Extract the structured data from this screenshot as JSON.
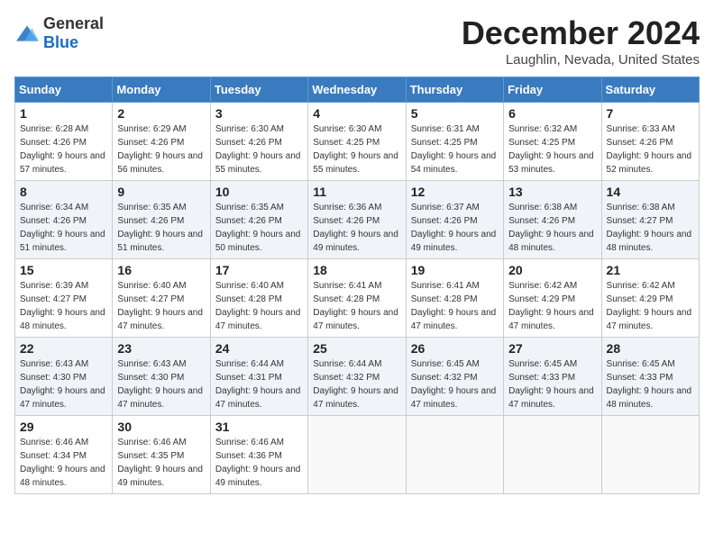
{
  "header": {
    "logo_general": "General",
    "logo_blue": "Blue",
    "month": "December 2024",
    "location": "Laughlin, Nevada, United States"
  },
  "days_of_week": [
    "Sunday",
    "Monday",
    "Tuesday",
    "Wednesday",
    "Thursday",
    "Friday",
    "Saturday"
  ],
  "weeks": [
    [
      {
        "day": "1",
        "sunrise": "6:28 AM",
        "sunset": "4:26 PM",
        "daylight": "9 hours and 57 minutes."
      },
      {
        "day": "2",
        "sunrise": "6:29 AM",
        "sunset": "4:26 PM",
        "daylight": "9 hours and 56 minutes."
      },
      {
        "day": "3",
        "sunrise": "6:30 AM",
        "sunset": "4:26 PM",
        "daylight": "9 hours and 55 minutes."
      },
      {
        "day": "4",
        "sunrise": "6:30 AM",
        "sunset": "4:25 PM",
        "daylight": "9 hours and 55 minutes."
      },
      {
        "day": "5",
        "sunrise": "6:31 AM",
        "sunset": "4:25 PM",
        "daylight": "9 hours and 54 minutes."
      },
      {
        "day": "6",
        "sunrise": "6:32 AM",
        "sunset": "4:25 PM",
        "daylight": "9 hours and 53 minutes."
      },
      {
        "day": "7",
        "sunrise": "6:33 AM",
        "sunset": "4:26 PM",
        "daylight": "9 hours and 52 minutes."
      }
    ],
    [
      {
        "day": "8",
        "sunrise": "6:34 AM",
        "sunset": "4:26 PM",
        "daylight": "9 hours and 51 minutes."
      },
      {
        "day": "9",
        "sunrise": "6:35 AM",
        "sunset": "4:26 PM",
        "daylight": "9 hours and 51 minutes."
      },
      {
        "day": "10",
        "sunrise": "6:35 AM",
        "sunset": "4:26 PM",
        "daylight": "9 hours and 50 minutes."
      },
      {
        "day": "11",
        "sunrise": "6:36 AM",
        "sunset": "4:26 PM",
        "daylight": "9 hours and 49 minutes."
      },
      {
        "day": "12",
        "sunrise": "6:37 AM",
        "sunset": "4:26 PM",
        "daylight": "9 hours and 49 minutes."
      },
      {
        "day": "13",
        "sunrise": "6:38 AM",
        "sunset": "4:26 PM",
        "daylight": "9 hours and 48 minutes."
      },
      {
        "day": "14",
        "sunrise": "6:38 AM",
        "sunset": "4:27 PM",
        "daylight": "9 hours and 48 minutes."
      }
    ],
    [
      {
        "day": "15",
        "sunrise": "6:39 AM",
        "sunset": "4:27 PM",
        "daylight": "9 hours and 48 minutes."
      },
      {
        "day": "16",
        "sunrise": "6:40 AM",
        "sunset": "4:27 PM",
        "daylight": "9 hours and 47 minutes."
      },
      {
        "day": "17",
        "sunrise": "6:40 AM",
        "sunset": "4:28 PM",
        "daylight": "9 hours and 47 minutes."
      },
      {
        "day": "18",
        "sunrise": "6:41 AM",
        "sunset": "4:28 PM",
        "daylight": "9 hours and 47 minutes."
      },
      {
        "day": "19",
        "sunrise": "6:41 AM",
        "sunset": "4:28 PM",
        "daylight": "9 hours and 47 minutes."
      },
      {
        "day": "20",
        "sunrise": "6:42 AM",
        "sunset": "4:29 PM",
        "daylight": "9 hours and 47 minutes."
      },
      {
        "day": "21",
        "sunrise": "6:42 AM",
        "sunset": "4:29 PM",
        "daylight": "9 hours and 47 minutes."
      }
    ],
    [
      {
        "day": "22",
        "sunrise": "6:43 AM",
        "sunset": "4:30 PM",
        "daylight": "9 hours and 47 minutes."
      },
      {
        "day": "23",
        "sunrise": "6:43 AM",
        "sunset": "4:30 PM",
        "daylight": "9 hours and 47 minutes."
      },
      {
        "day": "24",
        "sunrise": "6:44 AM",
        "sunset": "4:31 PM",
        "daylight": "9 hours and 47 minutes."
      },
      {
        "day": "25",
        "sunrise": "6:44 AM",
        "sunset": "4:32 PM",
        "daylight": "9 hours and 47 minutes."
      },
      {
        "day": "26",
        "sunrise": "6:45 AM",
        "sunset": "4:32 PM",
        "daylight": "9 hours and 47 minutes."
      },
      {
        "day": "27",
        "sunrise": "6:45 AM",
        "sunset": "4:33 PM",
        "daylight": "9 hours and 47 minutes."
      },
      {
        "day": "28",
        "sunrise": "6:45 AM",
        "sunset": "4:33 PM",
        "daylight": "9 hours and 48 minutes."
      }
    ],
    [
      {
        "day": "29",
        "sunrise": "6:46 AM",
        "sunset": "4:34 PM",
        "daylight": "9 hours and 48 minutes."
      },
      {
        "day": "30",
        "sunrise": "6:46 AM",
        "sunset": "4:35 PM",
        "daylight": "9 hours and 49 minutes."
      },
      {
        "day": "31",
        "sunrise": "6:46 AM",
        "sunset": "4:36 PM",
        "daylight": "9 hours and 49 minutes."
      },
      null,
      null,
      null,
      null
    ]
  ]
}
